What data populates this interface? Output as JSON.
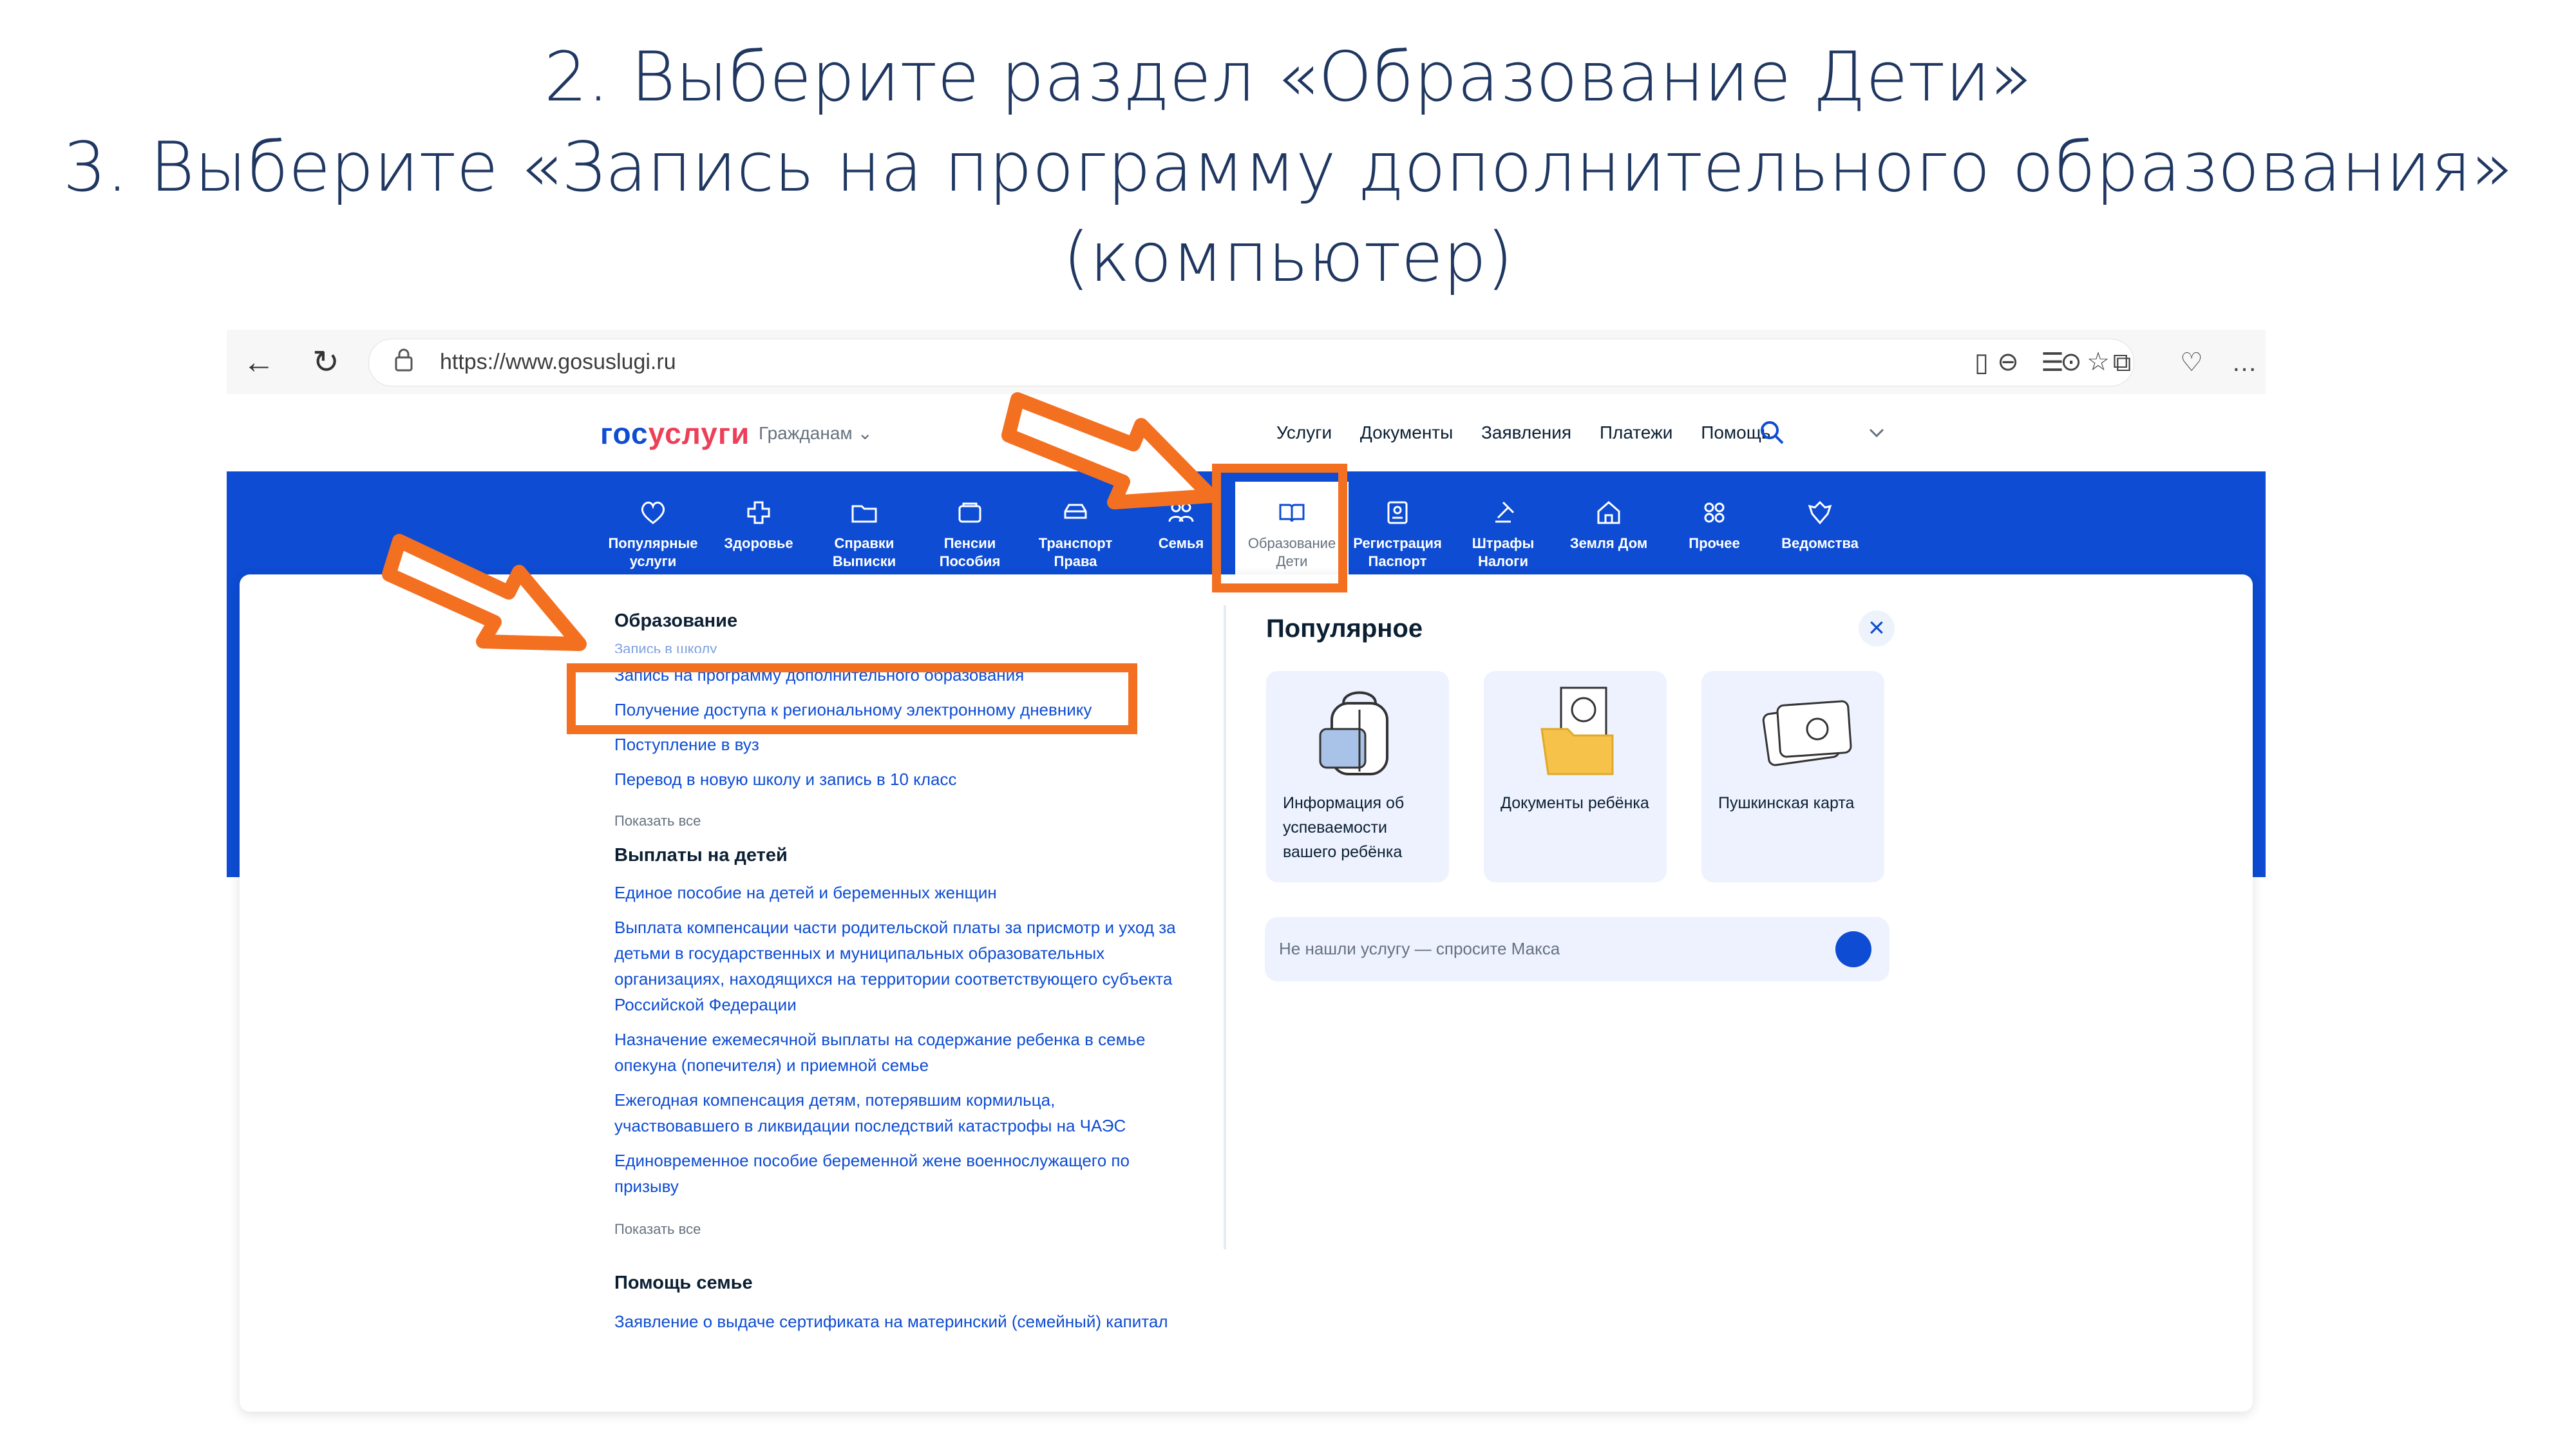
{
  "slide": {
    "line1": "2. Выберите раздел «Образование Дети»",
    "line2": "3. Выберите «Запись на программу дополнительного образования»",
    "line3": "(компьютер)"
  },
  "browser": {
    "url": "https://www.gosuslugi.ru",
    "back_icon": "arrow-left-icon",
    "reload_icon": "reload-icon"
  },
  "site": {
    "logo_a": "гос",
    "logo_b": "услуги",
    "citizens": "Гражданам ⌄",
    "top_menu": [
      "Услуги",
      "Документы",
      "Заявления",
      "Платежи",
      "Помощь"
    ]
  },
  "categories": [
    {
      "l1": "Популярные",
      "l2": "услуги"
    },
    {
      "l1": "Здоровье",
      "l2": ""
    },
    {
      "l1": "Справки",
      "l2": "Выписки"
    },
    {
      "l1": "Пенсии",
      "l2": "Пособия"
    },
    {
      "l1": "Транспорт",
      "l2": "Права"
    },
    {
      "l1": "Семья",
      "l2": ""
    },
    {
      "l1": "Образование",
      "l2": "Дети"
    },
    {
      "l1": "Регистрация",
      "l2": "Паспорт"
    },
    {
      "l1": "Штрафы",
      "l2": "Налоги"
    },
    {
      "l1": "Земля Дом",
      "l2": ""
    },
    {
      "l1": "Прочее",
      "l2": ""
    },
    {
      "l1": "Ведомства",
      "l2": ""
    }
  ],
  "education": {
    "title": "Образование",
    "hidden_item": "Запись в школу",
    "items": [
      "Запись на программу дополнительного образования",
      "Получение доступа к региональному электронному дневнику",
      "Поступление в вуз",
      "Перевод в новую школу и запись в 10 класс"
    ],
    "show_all": "Показать все"
  },
  "payments": {
    "title": "Выплаты на детей",
    "items": [
      "Единое пособие на детей и беременных женщин",
      "Выплата компенсации части родительской платы за присмотр и уход за детьми в государственных и муниципальных образовательных организациях, находящихся на территории соответствующего субъекта Российской Федерации",
      "Назначение ежемесячной выплаты на содержание ребенка в семье опекуна (попечителя) и приемной семье",
      "Ежегодная компенсация детям, потерявшим кормильца, участвовавшего в ликвидации последствий катастрофы на ЧАЭС",
      "Единовременное пособие беременной жене военнослужащего по призыву"
    ],
    "show_all": "Показать все"
  },
  "family": {
    "title": "Помощь семье",
    "items": [
      "Заявление о выдаче сертификата на материнский (семейный) капитал"
    ]
  },
  "popular": {
    "title": "Популярное",
    "cards": [
      "Информация об успеваемости вашего ребёнка",
      "Документы ребёнка",
      "Пушкинская карта"
    ],
    "ask": "Не нашли услугу — спросите Макса"
  },
  "colors": {
    "accent": "#0d4cd3",
    "highlight": "#f37021",
    "logo_red": "#ee3f58"
  }
}
